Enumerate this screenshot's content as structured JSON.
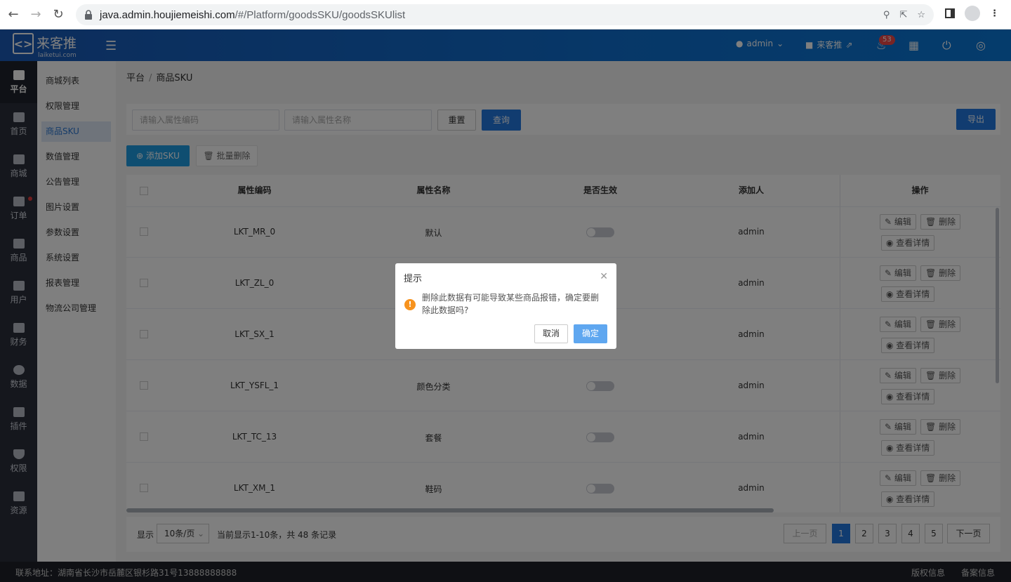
{
  "browser": {
    "url_main": "java.admin.houjiemeishi.com",
    "url_path": "/#/Platform/goodsSKU/goodsSKUlist"
  },
  "header": {
    "logo_text": "来客推",
    "logo_sub": "laiketui.com",
    "user": "admin",
    "store": "来客推",
    "notify_count": "53"
  },
  "side1": [
    {
      "label": "平台",
      "icon": "platform-icon"
    },
    {
      "label": "首页",
      "icon": "home-icon"
    },
    {
      "label": "商城",
      "icon": "mall-icon"
    },
    {
      "label": "订单",
      "icon": "order-icon"
    },
    {
      "label": "商品",
      "icon": "goods-icon"
    },
    {
      "label": "用户",
      "icon": "user-icon"
    },
    {
      "label": "财务",
      "icon": "wallet-icon"
    },
    {
      "label": "数据",
      "icon": "pie-chart-icon"
    },
    {
      "label": "插件",
      "icon": "puzzle-icon"
    },
    {
      "label": "权限",
      "icon": "shield-icon"
    },
    {
      "label": "资源",
      "icon": "image-icon"
    }
  ],
  "side2": [
    "商城列表",
    "权限管理",
    "商品SKU",
    "数值管理",
    "公告管理",
    "图片设置",
    "参数设置",
    "系统设置",
    "报表管理",
    "物流公司管理"
  ],
  "breadcrumb": {
    "root": "平台",
    "sep": "/",
    "current": "商品SKU"
  },
  "filter": {
    "code_placeholder": "请输入属性编码",
    "name_placeholder": "请输入属性名称",
    "reset": "重置",
    "query": "查询",
    "export": "导出"
  },
  "toolbar": {
    "add": "添加SKU",
    "batch_delete": "批量删除"
  },
  "table": {
    "headers": [
      "属性编码",
      "属性名称",
      "是否生效",
      "添加人",
      "操作"
    ],
    "rows": [
      {
        "code": "LKT_MR_0",
        "name": "默认",
        "adder": "admin"
      },
      {
        "code": "LKT_ZL_0",
        "name": "",
        "adder": "admin"
      },
      {
        "code": "LKT_SX_1",
        "name": "",
        "adder": "admin"
      },
      {
        "code": "LKT_YSFL_1",
        "name": "颜色分类",
        "adder": "admin"
      },
      {
        "code": "LKT_TC_13",
        "name": "套餐",
        "adder": "admin"
      },
      {
        "code": "LKT_XM_1",
        "name": "鞋码",
        "adder": "admin"
      }
    ],
    "op_edit": "编辑",
    "op_delete": "删除",
    "op_detail": "查看详情"
  },
  "pager": {
    "show": "显示",
    "page_size": "10条/页",
    "summary": "当前显示1-10条，共 48 条记录",
    "prev": "上一页",
    "pages": [
      "1",
      "2",
      "3",
      "4",
      "5"
    ],
    "next": "下一页"
  },
  "footer": {
    "address": "联系地址：湖南省长沙市岳麓区银杉路31号13888888888",
    "copyright": "版权信息",
    "icp": "备案信息"
  },
  "dialog": {
    "title": "提示",
    "message": "删除此数据有可能导致某些商品报错，确定要删除此数据吗?",
    "cancel": "取消",
    "confirm": "确定"
  }
}
